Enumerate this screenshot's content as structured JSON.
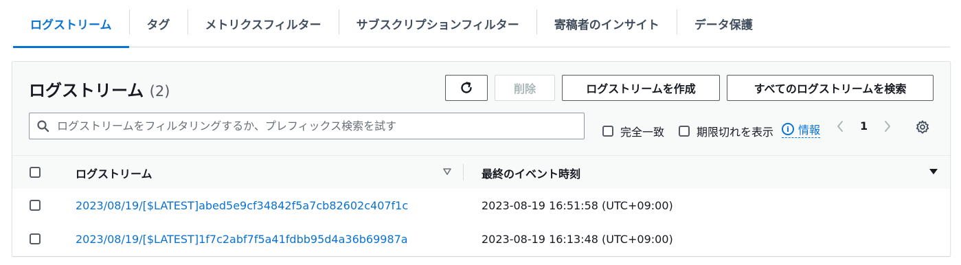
{
  "tabs": [
    {
      "label": "ログストリーム",
      "active": true
    },
    {
      "label": "タグ"
    },
    {
      "label": "メトリクスフィルター"
    },
    {
      "label": "サブスクリプションフィルター"
    },
    {
      "label": "寄稿者のインサイト"
    },
    {
      "label": "データ保護"
    }
  ],
  "panel": {
    "title": "ログストリーム",
    "count": "(2)",
    "buttons": {
      "refresh_icon": "refresh-icon",
      "delete": "削除",
      "create": "ログストリームを作成",
      "search_all": "すべてのログストリームを検索"
    },
    "search": {
      "placeholder": "ログストリームをフィルタリングするか、プレフィックス検索を試す",
      "value": ""
    },
    "options": {
      "exact_match": "完全一致",
      "show_expired": "期限切れを表示",
      "info": "情報"
    },
    "pagination": {
      "current_page": "1"
    }
  },
  "table": {
    "columns": [
      "ログストリーム",
      "最終のイベント時刻"
    ],
    "rows": [
      {
        "stream": "2023/08/19/[$LATEST]abed5e9cf34842f5a7cb82602c407f1c",
        "last_event": "2023-08-19 16:51:58 (UTC+09:00)"
      },
      {
        "stream": "2023/08/19/[$LATEST]1f7c2abf7f5a41fdbb95d4a36b69987a",
        "last_event": "2023-08-19 16:13:48 (UTC+09:00)"
      }
    ]
  },
  "colors": {
    "accent": "#0972d3",
    "text": "#16191f",
    "border": "#545b64"
  }
}
